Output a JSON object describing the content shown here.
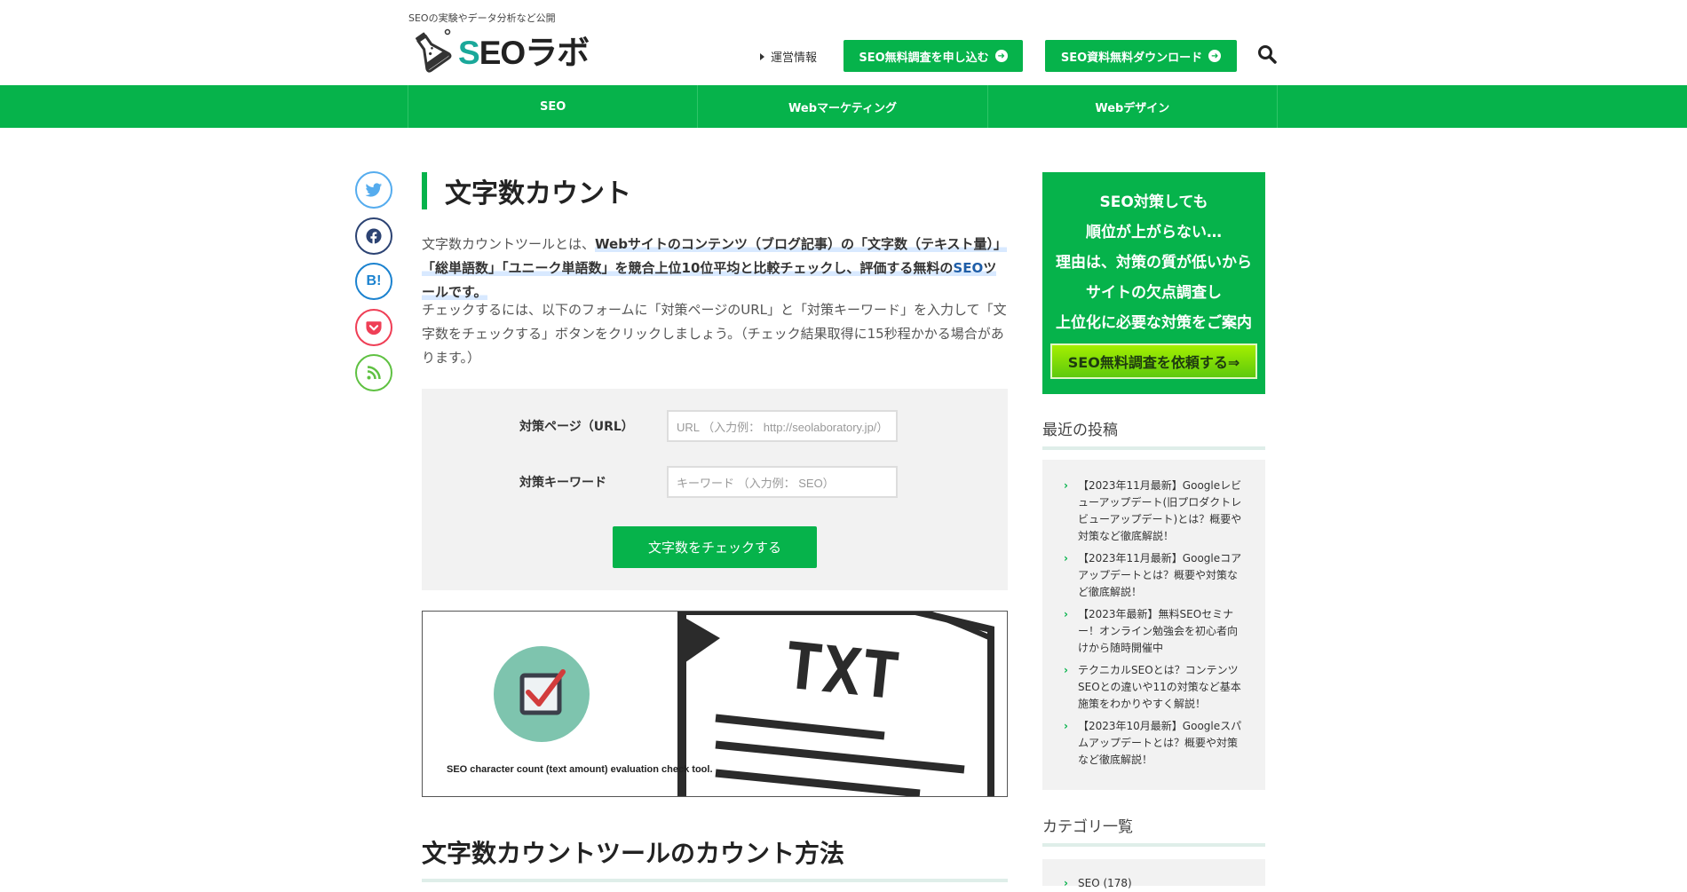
{
  "header": {
    "tagline": "SEOの実験やデータ分析など公開",
    "logo": {
      "s": "S",
      "rest": "EOラボ"
    },
    "about_link": "運営情報",
    "btn_survey": "SEO無料調査を申し込む",
    "btn_download": "SEO資料無料ダウンロード",
    "search_icon": "search-icon"
  },
  "nav": {
    "items": [
      "SEO",
      "Webマーケティング",
      "Webデザイン"
    ]
  },
  "share": {
    "icons": [
      "twitter-icon",
      "facebook-icon",
      "hatena-bookmark-icon",
      "pocket-icon",
      "rss-icon"
    ],
    "hatena_label": "B!"
  },
  "main": {
    "title": "文字数カウント",
    "intro_plain": "文字数カウントツールとは、",
    "intro_bold": "Webサイトのコンテンツ（ブログ記事）の「文字数（テキスト量）」「総単語数」「ユニーク単語数」を競合上位10位平均と比較チェックし、評価する無料の",
    "intro_seo": "SEO",
    "intro_end": "ツールです。",
    "howto": "チェックするには、以下のフォームに「対策ページのURL」と「対策キーワード」を入力して「文字数をチェックする」ボタンをクリックしましょう。（チェック結果取得に15秒程かかる場合があります。）",
    "form": {
      "url_label": "対策ページ（URL）",
      "url_placeholder": "URL （入力例： http://seolaboratory.jp/）",
      "kw_label": "対策キーワード",
      "kw_placeholder": "キーワード （入力例： SEO）",
      "submit": "文字数をチェックする"
    },
    "banner": {
      "txt": "TXT",
      "caption": "SEO character count (text amount) evaluation check tool."
    },
    "h2": "文字数カウントツールのカウント方法"
  },
  "sidebar": {
    "ad_lines": [
      "SEO対策しても",
      "順位が上がらない…",
      "理由は、対策の質が低いから",
      "サイトの欠点調査し",
      "上位化に必要な対策をご案内"
    ],
    "ad_button": "SEO無料調査を依頼する⇒",
    "recent_heading": "最近の投稿",
    "recent_posts": [
      "【2023年11月最新】Googleレビューアップデート(旧プロダクトレビューアップデート)とは？概要や対策など徹底解説！",
      "【2023年11月最新】Googleコアアップデートとは？概要や対策など徹底解説！",
      "【2023年最新】無料SEOセミナー！オンライン勉強会を初心者向けから随時開催中",
      "テクニカルSEOとは？コンテンツSEOとの違いや11の対策など基本施策をわかりやすく解説！",
      "【2023年10月最新】Googleスパムアップデートとは？概要や対策など徹底解説！"
    ],
    "category_heading": "カテゴリ一覧",
    "category_first": "SEO (178)"
  },
  "colors": {
    "brand_green": "#06b34b",
    "twitter": "#55acee",
    "facebook": "#2c4373",
    "hatena": "#1b82cf",
    "pocket": "#ef3f56",
    "rss": "#5fc142"
  }
}
